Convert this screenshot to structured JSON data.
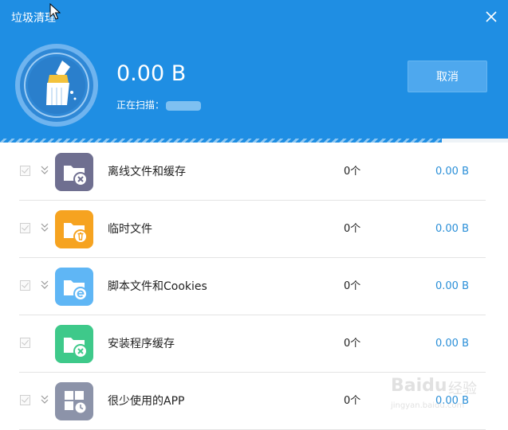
{
  "window": {
    "title": "垃圾清理"
  },
  "scan": {
    "total_size": "0.00 B",
    "status_label": "正在扫描：",
    "cancel_label": "取消",
    "progress": 0.87
  },
  "items": [
    {
      "label": "离线文件和缓存",
      "count": "0个",
      "size": "0.00 B",
      "icon": "offline-cache-folder-icon",
      "color": "#6f6f90",
      "checked": true,
      "expandable": true
    },
    {
      "label": "临时文件",
      "count": "0个",
      "size": "0.00 B",
      "icon": "temp-files-folder-icon",
      "color": "#f6a320",
      "checked": true,
      "expandable": true
    },
    {
      "label": "脚本文件和Cookies",
      "count": "0个",
      "size": "0.00 B",
      "icon": "cookies-folder-icon",
      "color": "#5fb6f5",
      "checked": true,
      "expandable": true
    },
    {
      "label": "安装程序缓存",
      "count": "0个",
      "size": "0.00 B",
      "icon": "installer-cache-folder-icon",
      "color": "#3ec98a",
      "checked": true,
      "expandable": false
    },
    {
      "label": "很少使用的APP",
      "count": "0个",
      "size": "0.00 B",
      "icon": "rarely-used-apps-icon",
      "color": "#8c93a9",
      "checked": true,
      "expandable": true
    }
  ],
  "watermark": {
    "brand": "Baidu",
    "cn": "经验",
    "url": "jingyan.baidu.com"
  }
}
